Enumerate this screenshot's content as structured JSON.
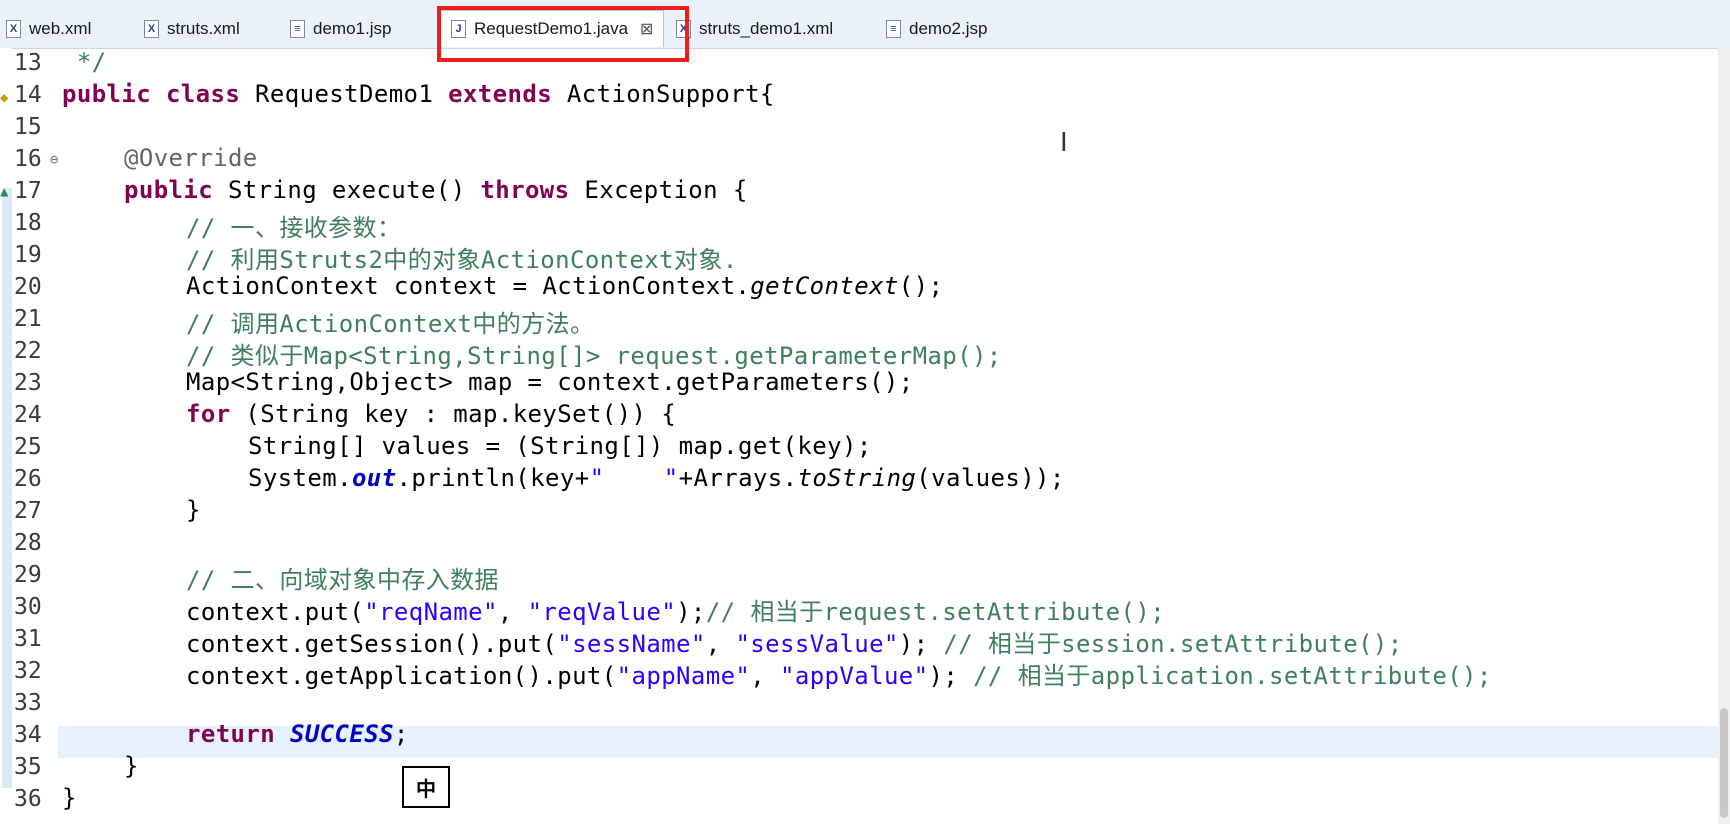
{
  "tabs": [
    {
      "label": "web.xml",
      "icon": "xml-file-icon"
    },
    {
      "label": "struts.xml",
      "icon": "xml-file-icon"
    },
    {
      "label": "demo1.jsp",
      "icon": "jsp-file-icon"
    },
    {
      "label": "RequestDemo1.java",
      "icon": "java-file-icon",
      "active": true
    },
    {
      "label": "struts_demo1.xml",
      "icon": "xml-file-icon"
    },
    {
      "label": "demo2.jsp",
      "icon": "jsp-file-icon"
    }
  ],
  "line_numbers": [
    "13",
    "14",
    "15",
    "16",
    "17",
    "18",
    "19",
    "20",
    "21",
    "22",
    "23",
    "24",
    "25",
    "26",
    "27",
    "28",
    "29",
    "30",
    "31",
    "32",
    "33",
    "34",
    "35",
    "36"
  ],
  "code": {
    "l13": " */",
    "l14_a": "public class",
    "l14_b": " RequestDemo1 ",
    "l14_c": "extends",
    "l14_d": " ActionSupport{",
    "l16": "@Override",
    "l17_a": "public",
    "l17_b": " String execute() ",
    "l17_c": "throws",
    "l17_d": " Exception {",
    "l18": "// 一、接收参数：",
    "l19": "// 利用Struts2中的对象ActionContext对象.",
    "l20_a": "ActionContext context = ActionContext.",
    "l20_b": "getContext",
    "l20_c": "();",
    "l21": "// 调用ActionContext中的方法。",
    "l22": "// 类似于Map<String,String[]> request.getParameterMap();",
    "l23": "Map<String,Object> map = context.getParameters();",
    "l24_a": "for",
    "l24_b": " (String key : map.keySet()) {",
    "l25": "String[] values = (String[]) map.get(key);",
    "l26_a": "System.",
    "l26_b": "out",
    "l26_c": ".println(key+",
    "l26_d": "\"    \"",
    "l26_e": "+Arrays.",
    "l26_f": "toString",
    "l26_g": "(values));",
    "l27": "}",
    "l29": "// 二、向域对象中存入数据",
    "l30_a": "context.put(",
    "l30_b": "\"reqName\"",
    "l30_c": ", ",
    "l30_d": "\"reqValue\"",
    "l30_e": ");",
    "l30_f": "// 相当于request.setAttribute();",
    "l31_a": "context.getSession().put(",
    "l31_b": "\"sessName\"",
    "l31_c": ", ",
    "l31_d": "\"sessValue\"",
    "l31_e": "); ",
    "l31_f": "// 相当于session.setAttribute();",
    "l32_a": "context.getApplication().put(",
    "l32_b": "\"appName\"",
    "l32_c": ", ",
    "l32_d": "\"appValue\"",
    "l32_e": "); ",
    "l32_f": "// 相当于application.setAttribute();",
    "l34_a": "return",
    "l34_b": " ",
    "l34_c": "SUCCESS",
    "l34_d": ";",
    "l35": "}",
    "l36": "}"
  },
  "ime_indicator": "中",
  "colors": {
    "keyword": "#7f0055",
    "comment": "#3f7f5f",
    "string": "#2a00ff",
    "field": "#0000c0",
    "highlight_box": "#ee1c1c"
  }
}
